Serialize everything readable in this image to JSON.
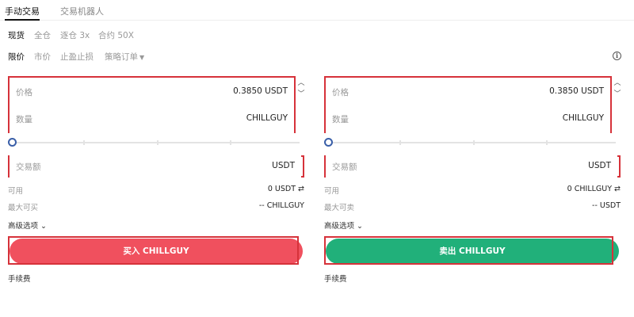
{
  "top_tabs": [
    {
      "label": "手动交易",
      "active": true
    },
    {
      "label": "交易机器人",
      "active": false
    }
  ],
  "modes": [
    {
      "label": "现货",
      "active": true
    },
    {
      "label": "全仓",
      "active": false
    },
    {
      "label": "逐仓 3x",
      "active": false
    },
    {
      "label": "合约 50X",
      "active": false
    }
  ],
  "order_tabs": [
    {
      "label": "限价",
      "active": true
    },
    {
      "label": "市价",
      "active": false
    },
    {
      "label": "止盈止损",
      "active": false
    },
    {
      "label": "策略订单",
      "active": false
    }
  ],
  "buy": {
    "price_label": "价格",
    "price_value": "0.3850 USDT",
    "qty_label": "数量",
    "qty_value": "CHILLGUY",
    "amount_label": "交易额",
    "amount_value": "USDT",
    "avail_label": "可用",
    "avail_value": "0 USDT ⇄",
    "max_label": "最大可买",
    "max_value": "-- CHILLGUY",
    "advanced_label": "高级选项",
    "button_label": "买入 CHILLGUY",
    "fee_label": "手续费"
  },
  "sell": {
    "price_label": "价格",
    "price_value": "0.3850 USDT",
    "qty_label": "数量",
    "qty_value": "CHILLGUY",
    "amount_label": "交易额",
    "amount_value": "USDT",
    "avail_label": "可用",
    "avail_value": "0 CHILLGUY ⇄",
    "max_label": "最大可卖",
    "max_value": "-- USDT",
    "advanced_label": "高级选项",
    "button_label": "卖出 CHILLGUY",
    "fee_label": "手续费"
  },
  "colors": {
    "buy": "#f0505e",
    "sell": "#21b07a",
    "highlight": "#d6323a",
    "slider": "#3a5fa8"
  },
  "icons": {
    "info": "info-circle-icon",
    "stepper_up": "chevron-up-icon",
    "stepper_down": "chevron-down-icon",
    "dropdown": "caret-down-icon",
    "swap": "swap-icon"
  }
}
